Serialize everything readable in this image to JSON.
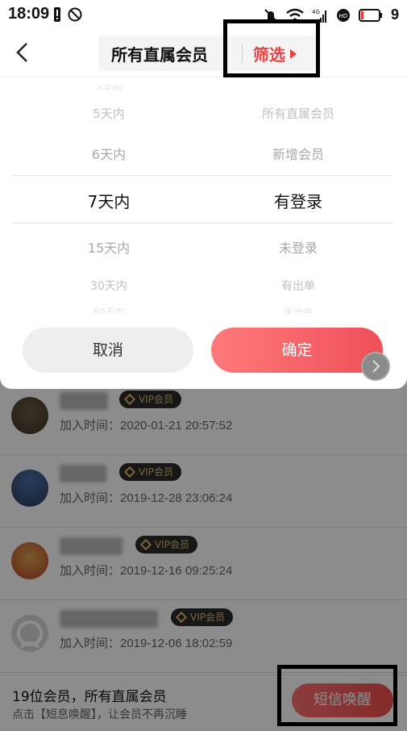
{
  "status_bar": {
    "time": "18:09",
    "battery": "9"
  },
  "header": {
    "title": "所有直属会员",
    "filter_label": "筛选"
  },
  "picker": {
    "left_options": [
      "5天内",
      "6天内",
      "7天内",
      "15天内",
      "30天内"
    ],
    "right_options": [
      "所有直属会员",
      "新增会员",
      "有登录",
      "未登录",
      "有出单"
    ],
    "selected_left": "7天内",
    "selected_right": "有登录",
    "cancel_label": "取消",
    "confirm_label": "确定"
  },
  "members": [
    {
      "vip": "VIP会员",
      "join_time": "加入时间：2020-01-21 20:57:52"
    },
    {
      "vip": "VIP会员",
      "join_time": "加入时间：2019-12-28 23:06:24"
    },
    {
      "vip": "VIP会员",
      "join_time": "加入时间：2019-12-16 09:25:24"
    },
    {
      "vip": "VIP会员",
      "join_time": "加入时间：2019-12-06 18:02:59"
    }
  ],
  "footer": {
    "count_text": "19位会员，所有直属会员",
    "hint_text": "点击【短息唤醒】，让会员不再沉睡",
    "sms_button": "短信唤醒"
  },
  "colors": {
    "accent": "#e84141",
    "vip_gold": "#e2b765"
  }
}
